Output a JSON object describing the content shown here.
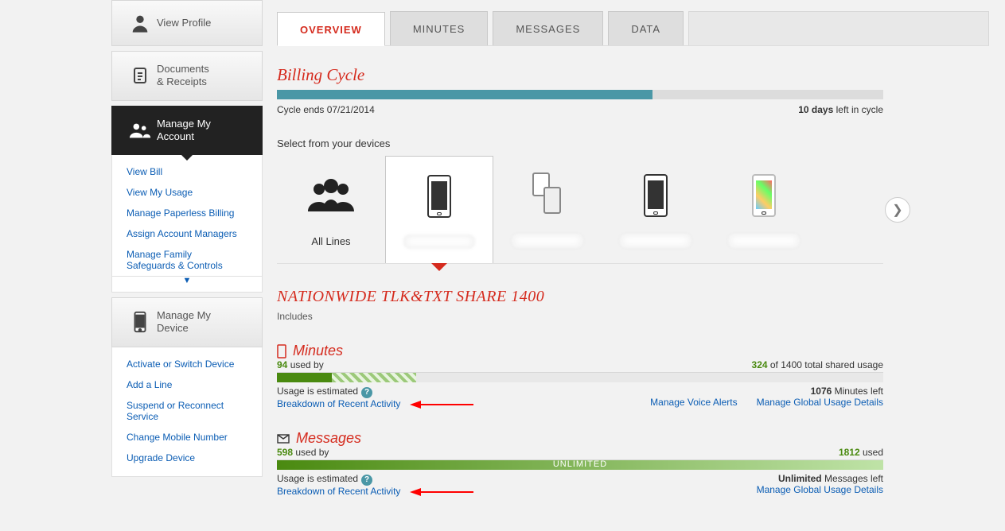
{
  "sidebar": {
    "view_profile": "View Profile",
    "docs_receipts_l1": "Documents",
    "docs_receipts_l2": "& Receipts",
    "manage_account_l1": "Manage My",
    "manage_account_l2": "Account",
    "account_links": {
      "view_bill": "View Bill",
      "view_usage": "View My Usage",
      "paperless": "Manage Paperless Billing",
      "assign_mgrs": "Assign Account Managers",
      "family_safe_l1": "Manage Family",
      "family_safe_l2": "Safeguards & Controls"
    },
    "manage_device_l1": "Manage My",
    "manage_device_l2": "Device",
    "device_links": {
      "activate": "Activate or Switch Device",
      "add_line": "Add a Line",
      "suspend_l1": "Suspend or Reconnect",
      "suspend_l2": "Service",
      "change_num": "Change Mobile Number",
      "upgrade": "Upgrade Device"
    }
  },
  "tabs": {
    "overview": "OVERVIEW",
    "minutes": "MINUTES",
    "messages": "MESSAGES",
    "data": "DATA"
  },
  "billing": {
    "title": "Billing Cycle",
    "ends": "Cycle ends 07/21/2014",
    "days_bold": "10 days",
    "days_rest": " left in cycle"
  },
  "devices": {
    "heading": "Select from your devices",
    "all_lines": "All Lines"
  },
  "plan": {
    "title": "NATIONWIDE TLK&TXT SHARE 1400",
    "includes": "Includes"
  },
  "minutes": {
    "title": "Minutes",
    "used_num": "94",
    "used_rest": " used by",
    "right_num": "324",
    "right_of": "  of  1400 total shared usage",
    "est": "Usage is estimated",
    "breakdown": "Breakdown of Recent Activity",
    "left_bold": "1076",
    "left_rest": " Minutes left",
    "alerts": "Manage Voice Alerts",
    "global": "Manage Global Usage Details"
  },
  "messages": {
    "title": "Messages",
    "used_num": "598",
    "used_rest": " used by",
    "right_num": "1812",
    "right_rest": " used",
    "unlimited": "UNLIMITED",
    "est": "Usage is estimated",
    "breakdown": "Breakdown of Recent Activity",
    "left_bold": "Unlimited",
    "left_rest": "  Messages left",
    "global": "Manage Global Usage Details"
  }
}
